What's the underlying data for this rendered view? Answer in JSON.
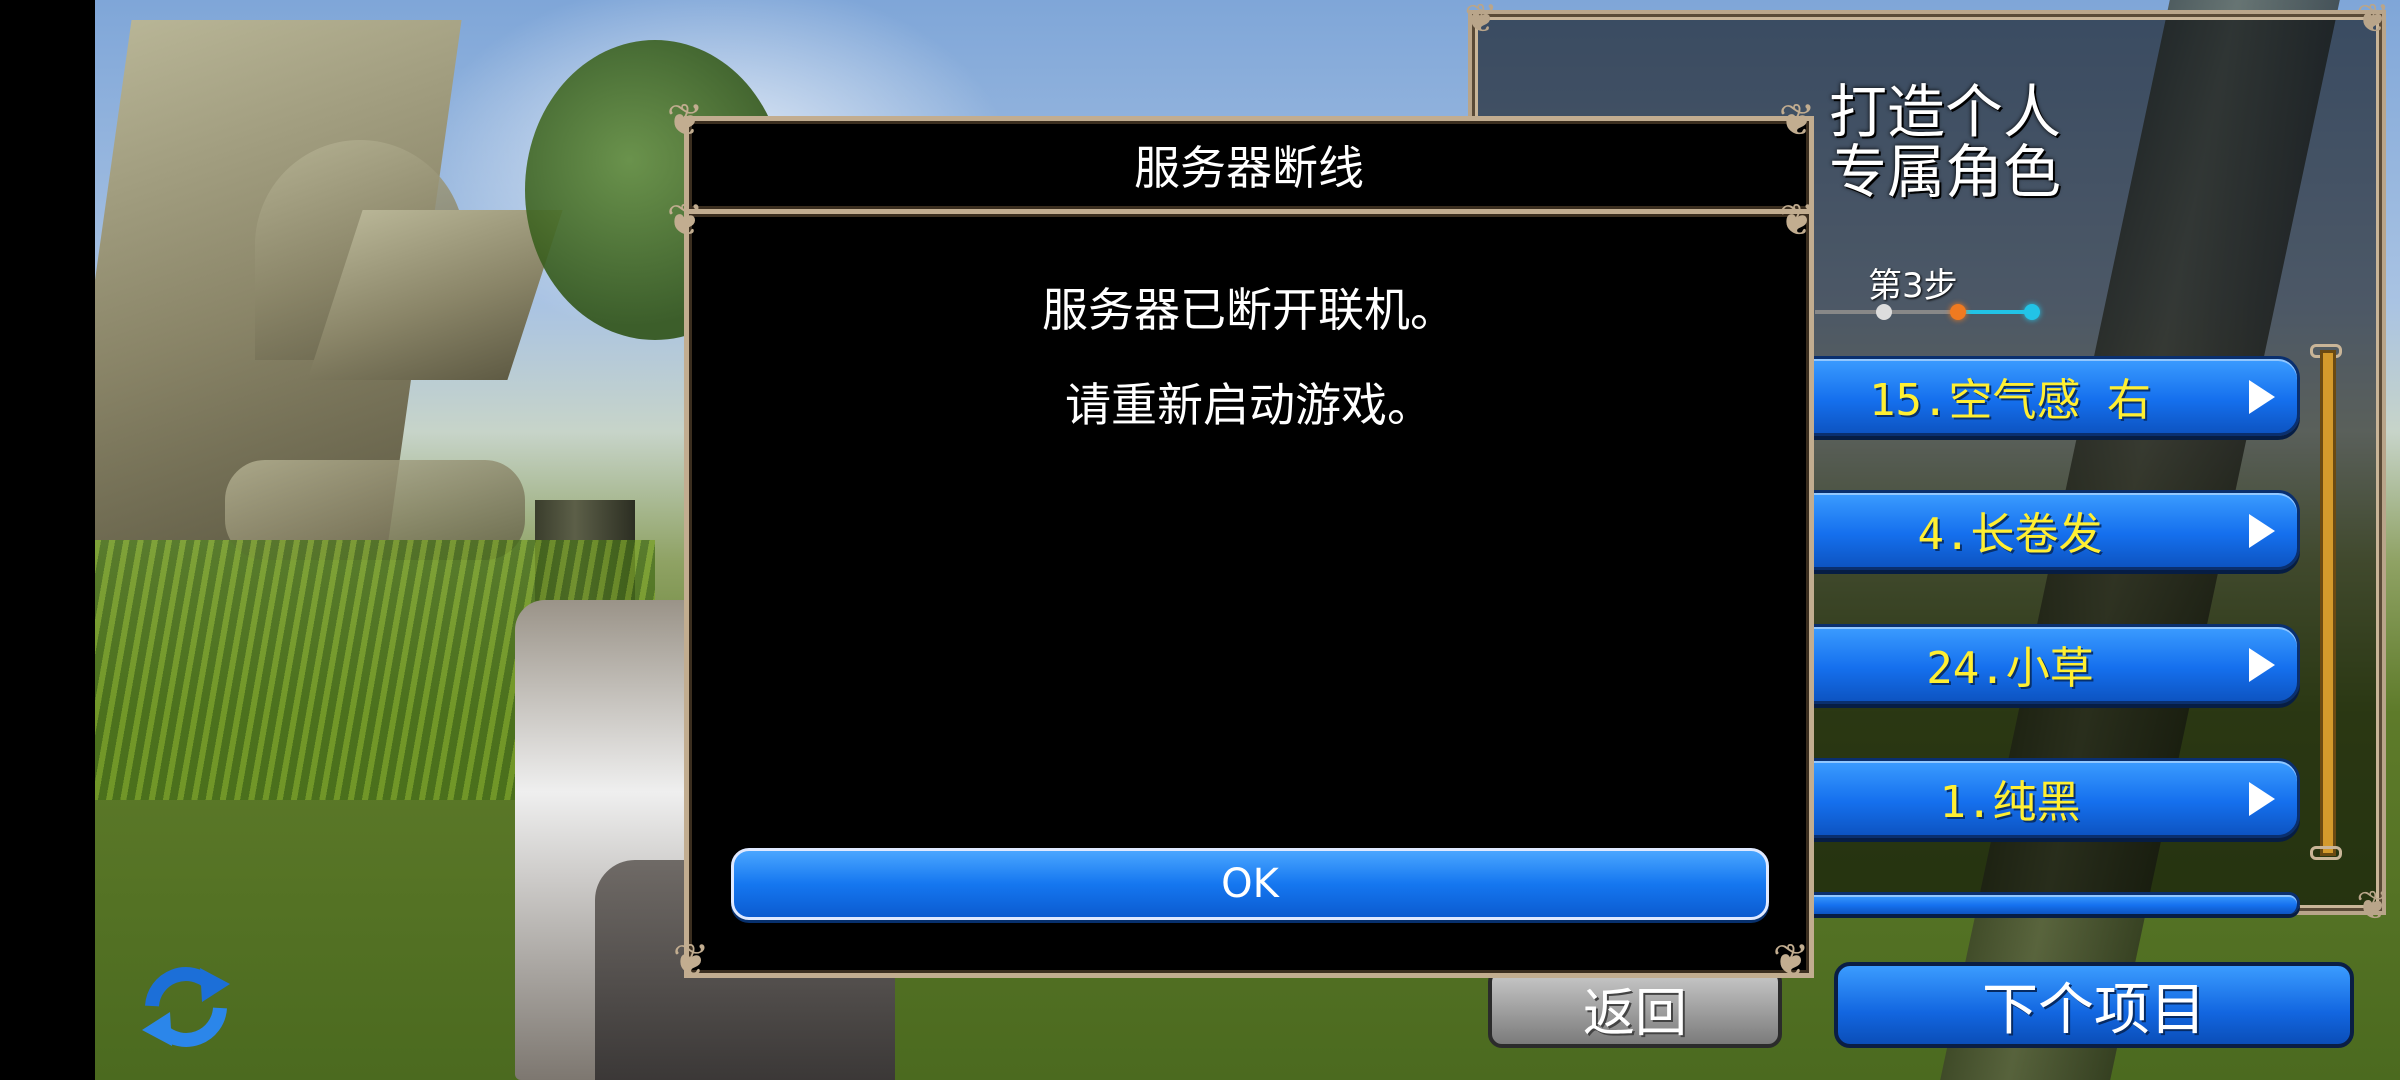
{
  "dialog": {
    "title": "服务器断线",
    "message_line1": "服务器已断开联机。",
    "message_line2": "请重新启动游戏。",
    "ok_label": "OK"
  },
  "right_panel": {
    "title": "打造个人\n专属角色",
    "step_label": "第3步",
    "options": [
      {
        "label": "15.空气感 右"
      },
      {
        "label": "4.长卷发"
      },
      {
        "label": "24.小草"
      },
      {
        "label": "1.纯黑"
      }
    ]
  },
  "footer": {
    "back_label": "返回",
    "next_label": "下个项目"
  },
  "icons": {
    "refresh": "refresh-icon",
    "option_arrow": "arrow-right-icon",
    "corner": "ornament-corner-icon"
  },
  "colors": {
    "button_blue": "#1570ee",
    "option_text": "#ffef32",
    "frame": "#c2ad90",
    "step_active": "#22c3e6",
    "step_current": "#f07a20"
  }
}
